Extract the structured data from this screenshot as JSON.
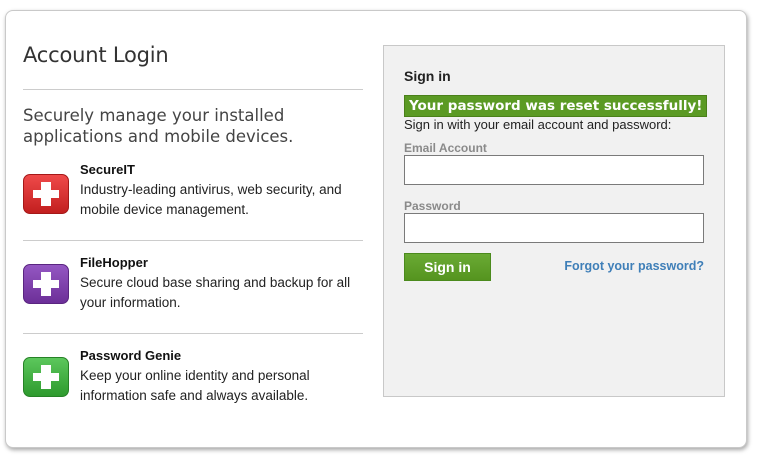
{
  "page": {
    "title": "Account Login",
    "tagline": "Securely manage your installed applications and mobile devices."
  },
  "products": [
    {
      "name": "SecureIT",
      "description": "Industry-leading antivirus, web security, and mobile device management.",
      "icon": "red-plus-icon",
      "color": "#d22a2a"
    },
    {
      "name": "FileHopper",
      "description": "Secure cloud base sharing and backup for all your information.",
      "icon": "purple-plus-icon",
      "color": "#7a3aa6"
    },
    {
      "name": "Password Genie",
      "description": "Keep your online identity and personal information safe and always available.",
      "icon": "green-plus-icon",
      "color": "#3aa53a"
    }
  ],
  "signin": {
    "title": "Sign in",
    "success_message": "Your password was reset successfully!",
    "instruction": "Sign in with your email account and password:",
    "email_label": "Email Account",
    "email_value": "",
    "password_label": "Password",
    "password_value": "",
    "button_label": "Sign in",
    "forgot_link": "Forgot your password?"
  },
  "colors": {
    "success_bg": "#5b9a24",
    "button_bg": "#5e9e28",
    "link": "#3f7fb8",
    "panel_bg": "#f1f1f1"
  }
}
